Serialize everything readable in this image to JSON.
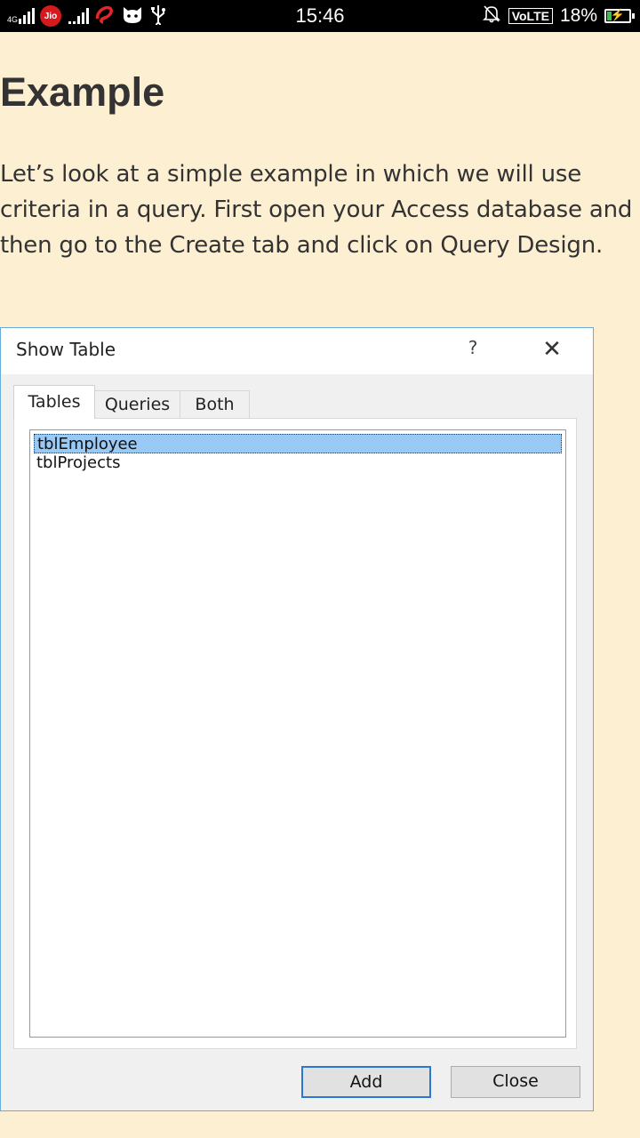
{
  "status_bar": {
    "network": "4G",
    "carrier_logo": "Jio",
    "time": "15:46",
    "volte": "VoLTE",
    "battery": "18%",
    "battery_level": 0.18,
    "icons": [
      "signal-icon",
      "jio-icon",
      "signal-icon",
      "airtel-icon",
      "cat-icon",
      "usb-icon",
      "bell-off-icon",
      "battery-charging-icon"
    ]
  },
  "article": {
    "heading": "Example",
    "paragraph": "Let’s look at a simple example in which we will use criteria in a query. First open your Access database and then go to the Create tab and click on Query Design."
  },
  "dialog": {
    "title": "Show Table",
    "help": "?",
    "close_glyph": "✕",
    "tabs": [
      {
        "label": "Tables",
        "active": true
      },
      {
        "label": "Queries",
        "active": false
      },
      {
        "label": "Both",
        "active": false
      }
    ],
    "items": [
      {
        "label": "tblEmployee",
        "selected": true
      },
      {
        "label": "tblProjects",
        "selected": false
      }
    ],
    "add_label": "Add",
    "close_label": "Close",
    "colors": {
      "border": "#6aaad9",
      "selection": "#99c9f5",
      "default_button_border": "#2b78d2"
    }
  }
}
